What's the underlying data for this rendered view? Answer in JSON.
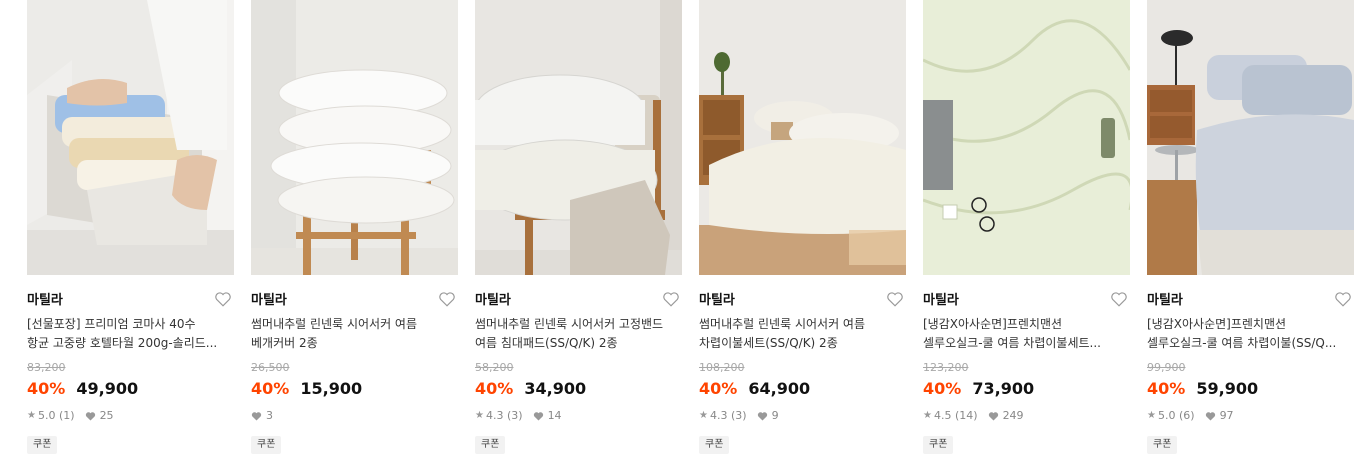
{
  "products": [
    {
      "brand": "마틸라",
      "title_line1": "[선물포장] 프리미엄 코마사 40수",
      "title_line2": "항균 고중량 호텔타월 200g-솔리드...",
      "original_price": "83,200",
      "discount": "40%",
      "price": "49,900",
      "rating": "5.0",
      "review_count": "(1)",
      "likes": "25",
      "badge": "쿠폰",
      "image": "towels-box"
    },
    {
      "brand": "마틸라",
      "title_line1": "썸머내추럴 린넨룩 시어서커 여름",
      "title_line2": "베개커버 2종",
      "original_price": "26,500",
      "discount": "40%",
      "price": "15,900",
      "rating": "",
      "review_count": "",
      "likes": "3",
      "badge": "쿠폰",
      "image": "pillows-chair"
    },
    {
      "brand": "마틸라",
      "title_line1": "썸머내추럴 린넨룩 시어서커 고정밴드",
      "title_line2": "여름 침대패드(SS/Q/K) 2종",
      "original_price": "58,200",
      "discount": "40%",
      "price": "34,900",
      "rating": "4.3",
      "review_count": "(3)",
      "likes": "14",
      "badge": "쿠폰",
      "image": "pads-chair"
    },
    {
      "brand": "마틸라",
      "title_line1": "썸머내추럴 린넨룩 시어서커 여름",
      "title_line2": "차렵이불세트(SS/Q/K) 2종",
      "original_price": "108,200",
      "discount": "40%",
      "price": "64,900",
      "rating": "4.3",
      "review_count": "(3)",
      "likes": "9",
      "badge": "쿠폰",
      "image": "bedroom"
    },
    {
      "brand": "마틸라",
      "title_line1": "[냉감X아사순면]프렌치맨션",
      "title_line2": "셀루오실크-쿨 여름 차렵이불세트...",
      "original_price": "123,200",
      "discount": "40%",
      "price": "73,900",
      "rating": "4.5",
      "review_count": "(14)",
      "likes": "249",
      "badge": "쿠폰",
      "image": "green-bedding"
    },
    {
      "brand": "마틸라",
      "title_line1": "[냉감X아사순면]프렌치맨션",
      "title_line2": "셀루오실크-쿨 여름 차렵이불(SS/Q...",
      "original_price": "99,900",
      "discount": "40%",
      "price": "59,900",
      "rating": "5.0",
      "review_count": "(6)",
      "likes": "97",
      "badge": "쿠폰",
      "image": "blue-bedroom"
    }
  ],
  "colors": {
    "discount": "#ff4400",
    "strike": "#a8a8a8",
    "meta": "#888888",
    "badge_bg": "#f2f2f2"
  }
}
